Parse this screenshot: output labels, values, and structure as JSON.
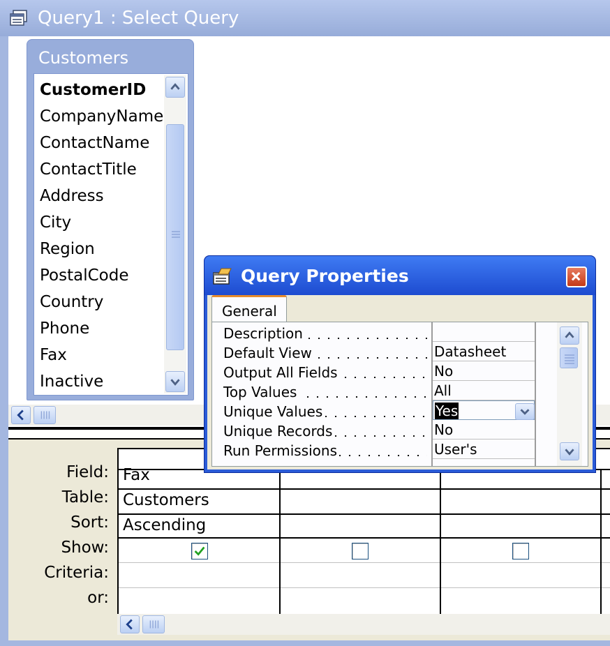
{
  "window": {
    "title": "Query1 : Select Query"
  },
  "field_list": {
    "title": "Customers",
    "fields": [
      "CustomerID",
      "CompanyName",
      "ContactName",
      "ContactTitle",
      "Address",
      "City",
      "Region",
      "PostalCode",
      "Country",
      "Phone",
      "Fax",
      "Inactive"
    ],
    "primary_key": "CustomerID"
  },
  "grid": {
    "row_labels": [
      "Field:",
      "Table:",
      "Sort:",
      "Show:",
      "Criteria:",
      "or:"
    ],
    "columns": [
      {
        "field": "Fax",
        "table": "Customers",
        "sort": "Ascending",
        "show": true,
        "criteria": "",
        "or": ""
      },
      {
        "field": "",
        "table": "",
        "sort": "",
        "show": false,
        "criteria": "",
        "or": ""
      },
      {
        "field": "",
        "table": "",
        "sort": "",
        "show": false,
        "criteria": "",
        "or": ""
      }
    ]
  },
  "dialog": {
    "title": "Query Properties",
    "tab": "General",
    "properties": [
      {
        "label": "Description",
        "value": ""
      },
      {
        "label": "Default View",
        "value": "Datasheet"
      },
      {
        "label": "Output All Fields",
        "value": "No"
      },
      {
        "label": "Top Values",
        "value": "All"
      },
      {
        "label": "Unique Values",
        "value": "Yes"
      },
      {
        "label": "Unique Records",
        "value": "No"
      },
      {
        "label": "Run Permissions",
        "value": "User's"
      }
    ]
  },
  "icons": {
    "title": "query-icon",
    "dialog_title": "properties-icon",
    "close": "close-icon",
    "scroll_up": "scroll-up-arrow-icon",
    "scroll_down": "scroll-down-arrow-icon",
    "scroll_left": "scroll-left-arrow-icon",
    "dropdown": "dropdown-arrow-icon",
    "checkmark": "checkmark-icon"
  },
  "colors": {
    "titlebar": "#97acd9",
    "dialog_titlebar": "#1d4bd0",
    "close_button": "#c53a17",
    "tab_accent": "#e68b2c",
    "checkmark": "#21a121"
  }
}
